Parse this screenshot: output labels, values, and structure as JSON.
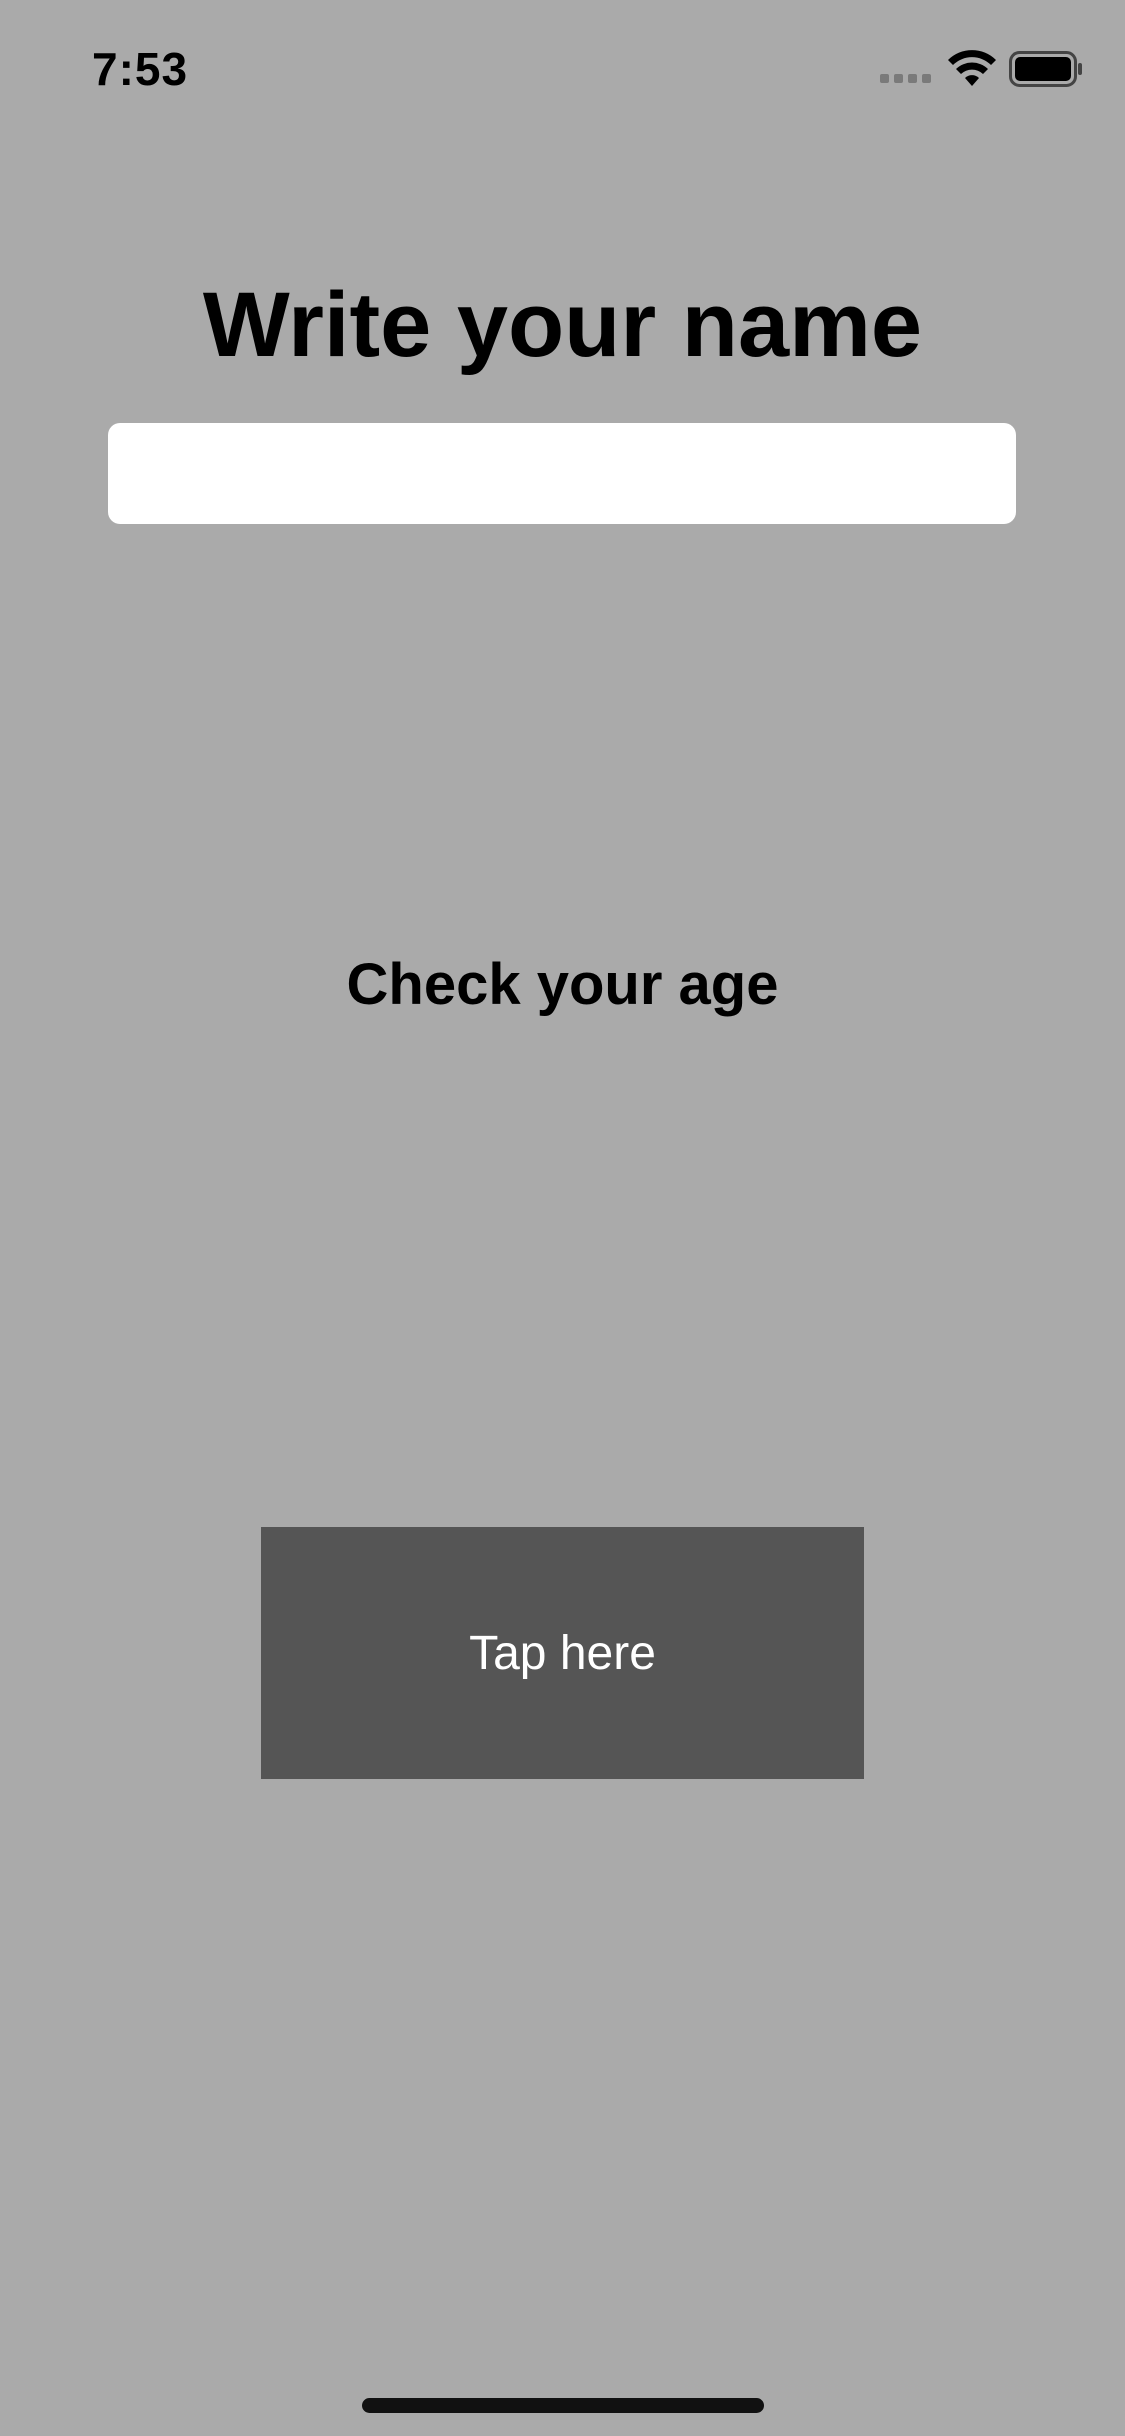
{
  "status_bar": {
    "time": "7:53",
    "signal_icon": "cellular-signal-icon",
    "wifi_icon": "wifi-icon",
    "battery_icon": "battery-icon"
  },
  "main": {
    "title": "Write your name",
    "name_input": {
      "value": "",
      "placeholder": ""
    },
    "subtitle": "Check your age",
    "tap_button_label": "Tap here"
  },
  "colors": {
    "background": "#aaaaaa",
    "button_background": "#555555",
    "button_text": "#ffffff",
    "input_background": "#ffffff"
  }
}
